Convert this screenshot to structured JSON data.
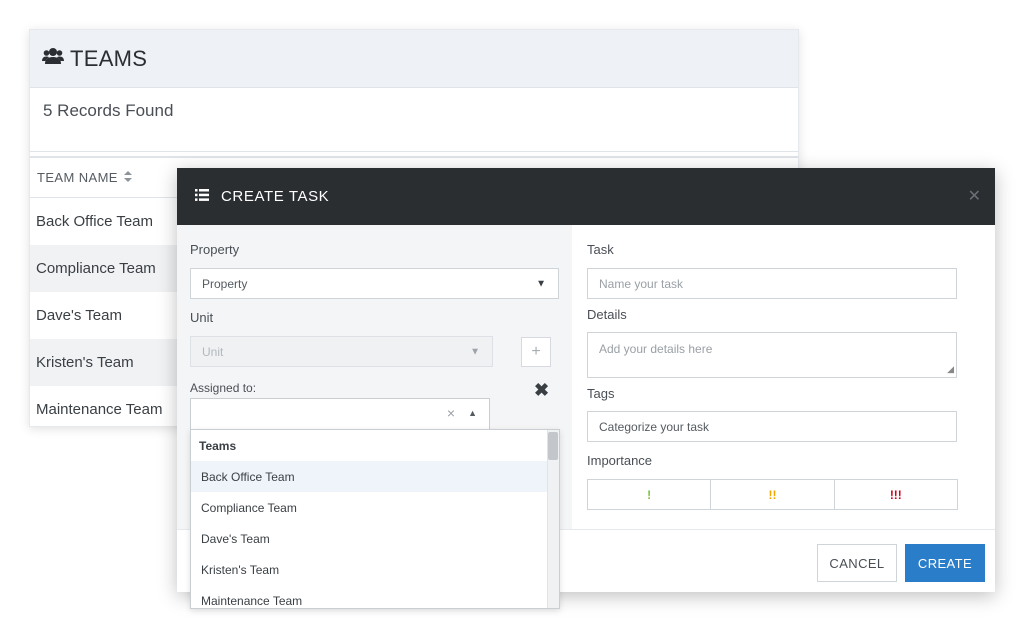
{
  "teams": {
    "title": "TEAMS",
    "count": "5 Records Found",
    "column_team_name": "TEAM NAME",
    "rows": [
      "Back Office Team",
      "Compliance Team",
      "Dave's Team",
      "Kristen's Team",
      "Maintenance Team"
    ]
  },
  "modal": {
    "title": "CREATE TASK",
    "close": "✕",
    "property_label": "Property",
    "property_value": "Property",
    "unit_label": "Unit",
    "unit_placeholder": "Unit",
    "plus": "+",
    "assigned_label": "Assigned to:",
    "remove": "✖",
    "clear": "×",
    "task_label": "Task",
    "task_placeholder": "Name your task",
    "details_label": "Details",
    "details_placeholder": "Add your details here",
    "tags_label": "Tags",
    "tags_placeholder": "Categorize your task",
    "importance_label": "Importance",
    "importance": [
      {
        "label": "!",
        "color": "#7ac142"
      },
      {
        "label": "!!",
        "color": "#f0a800"
      },
      {
        "label": "!!!",
        "color": "#d0021b"
      }
    ],
    "cancel": "CANCEL",
    "create": "CREATE"
  },
  "dropdown": {
    "group": "Teams",
    "items": [
      "Back Office Team",
      "Compliance Team",
      "Dave's Team",
      "Kristen's Team",
      "Maintenance Team"
    ]
  },
  "colors": {
    "primary": "#2a7dc9",
    "header_dark": "#2b2e31"
  }
}
